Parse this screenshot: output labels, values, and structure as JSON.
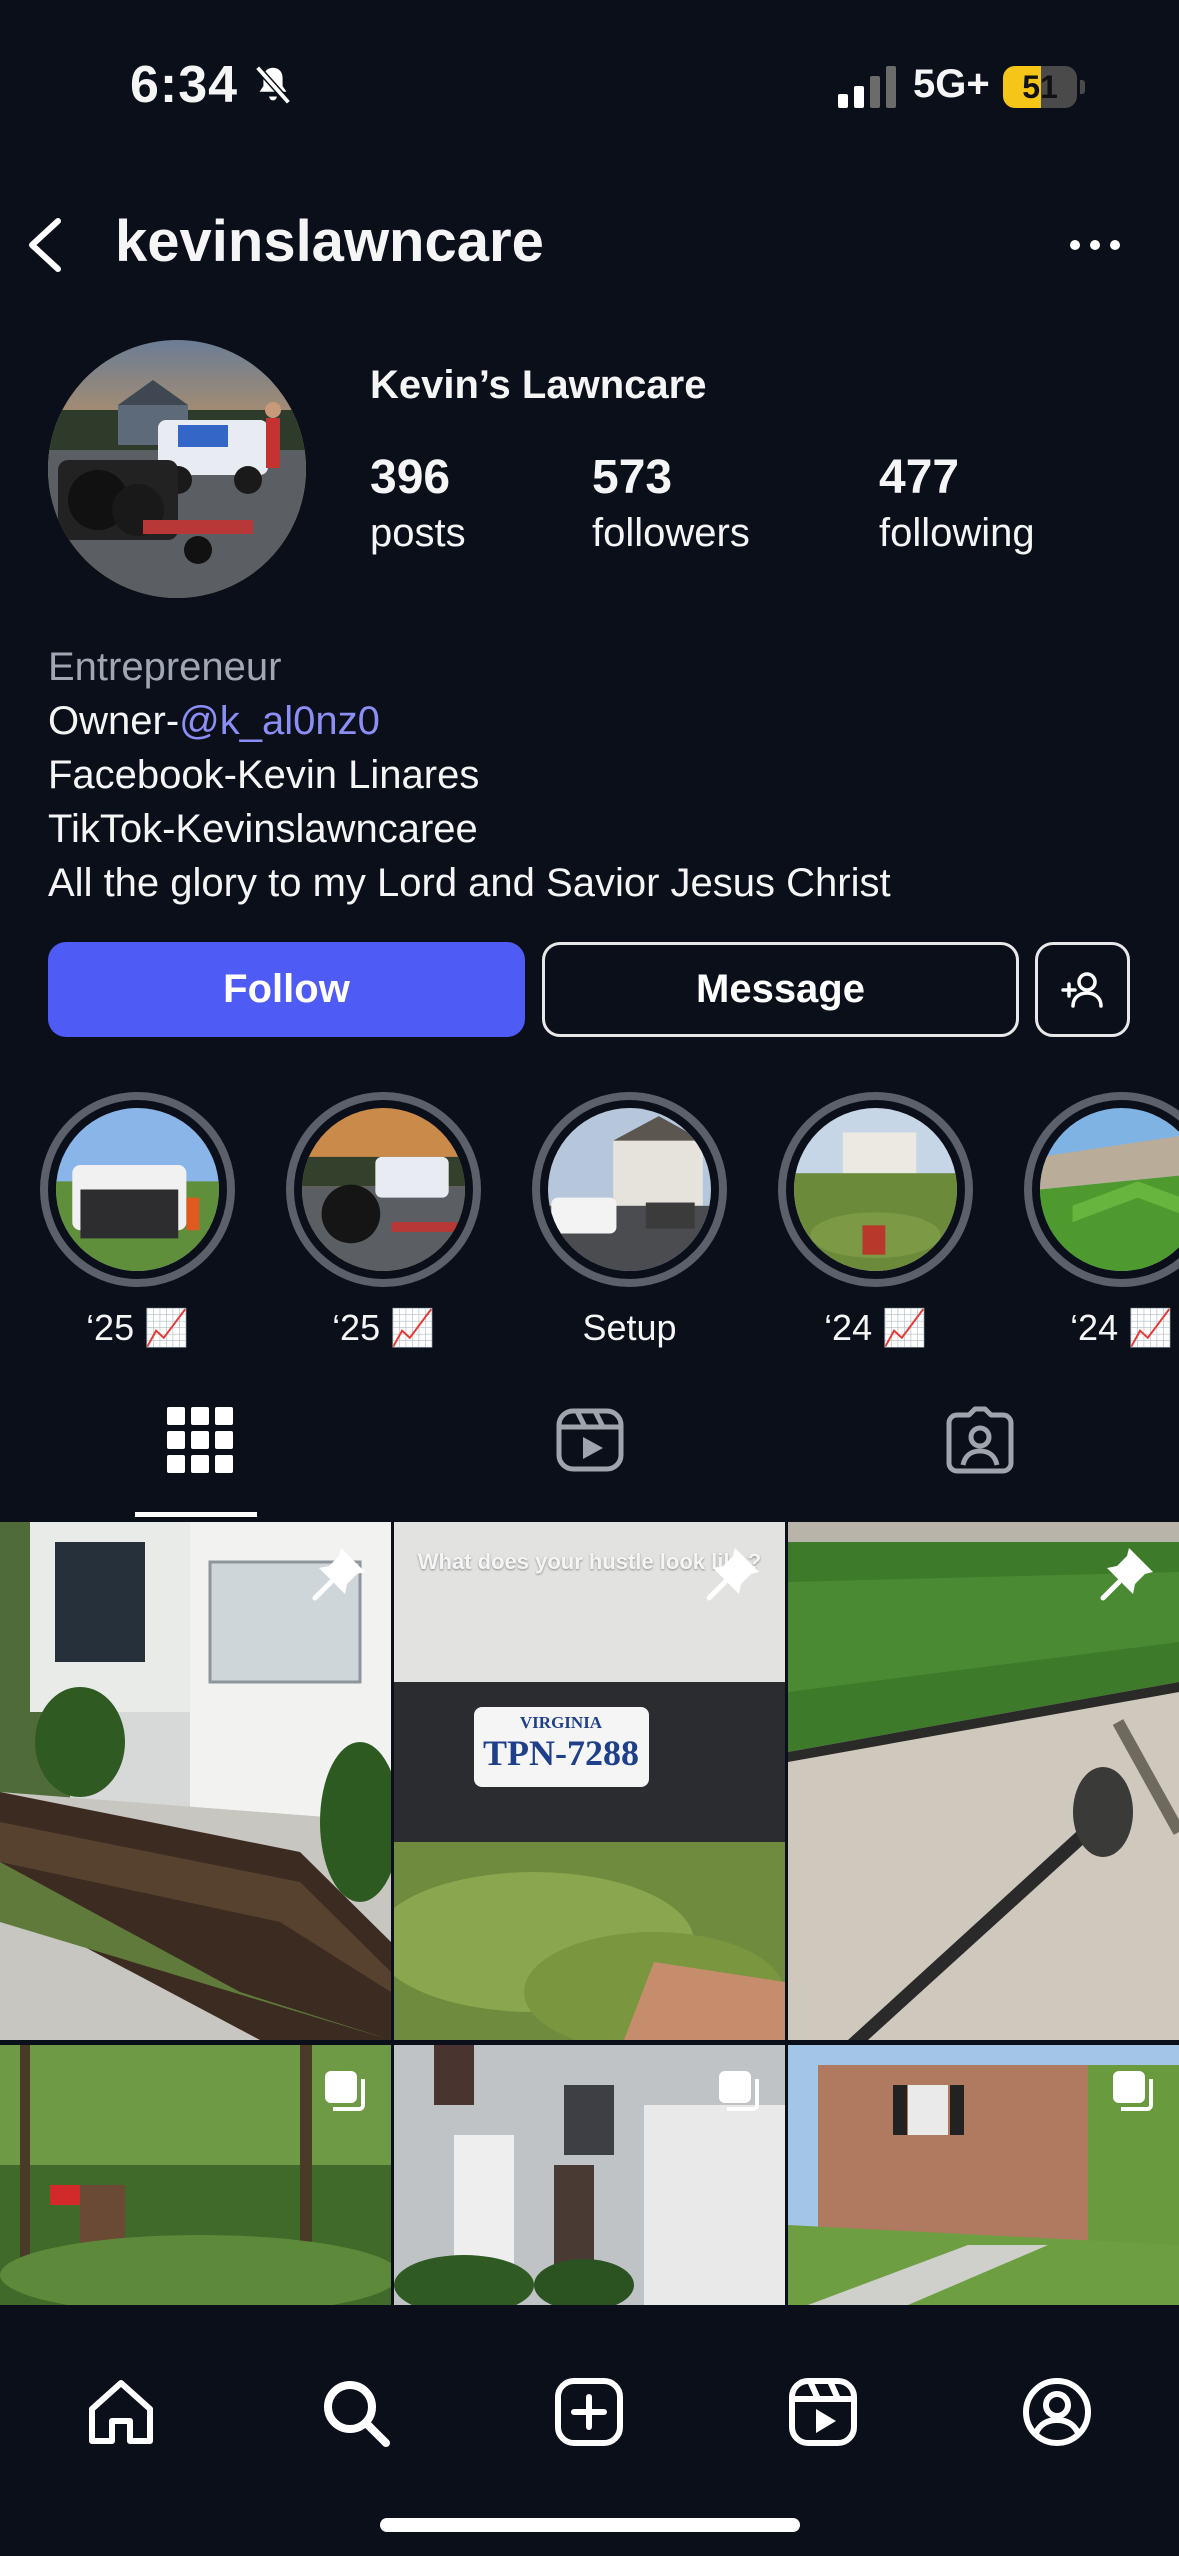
{
  "status_bar": {
    "time": "6:34",
    "network": "5G+",
    "battery_level": "51",
    "battery_fraction": 0.51
  },
  "header": {
    "username": "kevinslawncare"
  },
  "profile": {
    "display_name": "Kevin’s Lawncare",
    "stats": {
      "posts_count": "396",
      "posts_label": "posts",
      "followers_count": "573",
      "followers_label": "followers",
      "following_count": "477",
      "following_label": "following"
    },
    "bio": {
      "category": "Entrepreneur",
      "owner_prefix": "Owner-",
      "owner_mention": "@k_al0nz0",
      "line_facebook": "Facebook-Kevin Linares",
      "line_tiktok": "TikTok-Kevinslawncaree",
      "line_faith": "All the glory to my Lord and Savior Jesus Christ"
    }
  },
  "actions": {
    "follow_label": "Follow",
    "message_label": "Message"
  },
  "highlights": [
    {
      "label": "‘25 📈"
    },
    {
      "label": "‘25 📈"
    },
    {
      "label": "Setup"
    },
    {
      "label": "‘24 📈"
    },
    {
      "label": "‘24 📈"
    }
  ],
  "tabs": [
    "grid-icon",
    "reels-icon",
    "tagged-icon"
  ],
  "grid": {
    "post2_overlay": "What does your hustle look like?"
  },
  "nav": [
    "home-icon",
    "search-icon",
    "create-icon",
    "reels-icon",
    "profile-icon"
  ],
  "colors": {
    "background": "#0b0f19",
    "accent": "#4f5bf5",
    "mention": "#8b8ef5",
    "battery": "#f5c518"
  }
}
